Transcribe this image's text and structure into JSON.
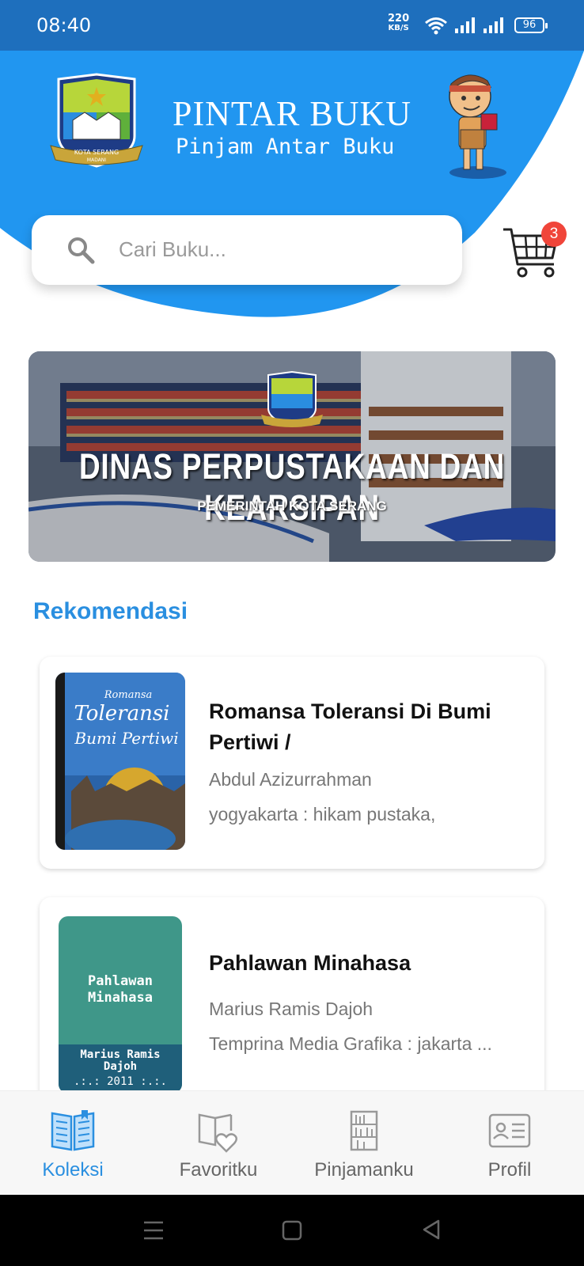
{
  "status_bar": {
    "time": "08:40",
    "net_speed_value": "220",
    "net_speed_unit": "KB/S",
    "battery": "96"
  },
  "header": {
    "title": "PINTAR BUKU",
    "subtitle": "Pinjam Antar Buku",
    "logo_text": "KOTA SERANG",
    "logo_subtext": "MADANI"
  },
  "search": {
    "placeholder": "Cari Buku..."
  },
  "cart": {
    "badge_count": "3"
  },
  "banner": {
    "title": "DINAS PERPUSTAKAAN DAN KEARSIPAN",
    "subtitle": "PEMERINTAH KOTA SERANG"
  },
  "recommendations": {
    "section_title": "Rekomendasi",
    "books": [
      {
        "title": "Romansa Toleransi Di Bumi Pertiwi /",
        "author": "Abdul Azizurrahman",
        "publisher": "yogyakarta : hikam pustaka,",
        "cover_text": [
          "Romansa",
          "Toleransi",
          "Bumi Pertiwi"
        ]
      },
      {
        "title": "Pahlawan Minahasa",
        "author": "Marius Ramis Dajoh",
        "publisher": "Temprina Media Grafika : jakarta ...",
        "cover_title": "Pahlawan\nMinahasa",
        "cover_author": "Marius Ramis\nDajoh",
        "cover_year": ".:.: 2011 :.:."
      }
    ]
  },
  "bottom_nav": {
    "items": [
      {
        "label": "Koleksi",
        "icon": "open-book-icon",
        "active": true
      },
      {
        "label": "Favoritku",
        "icon": "book-heart-icon",
        "active": false
      },
      {
        "label": "Pinjamanku",
        "icon": "bookshelf-icon",
        "active": false
      },
      {
        "label": "Profil",
        "icon": "id-card-icon",
        "active": false
      }
    ]
  },
  "colors": {
    "primary": "#2196f0",
    "status_bar": "#1e6fbd",
    "accent_text": "#2a8fe0",
    "badge": "#f0453a"
  }
}
